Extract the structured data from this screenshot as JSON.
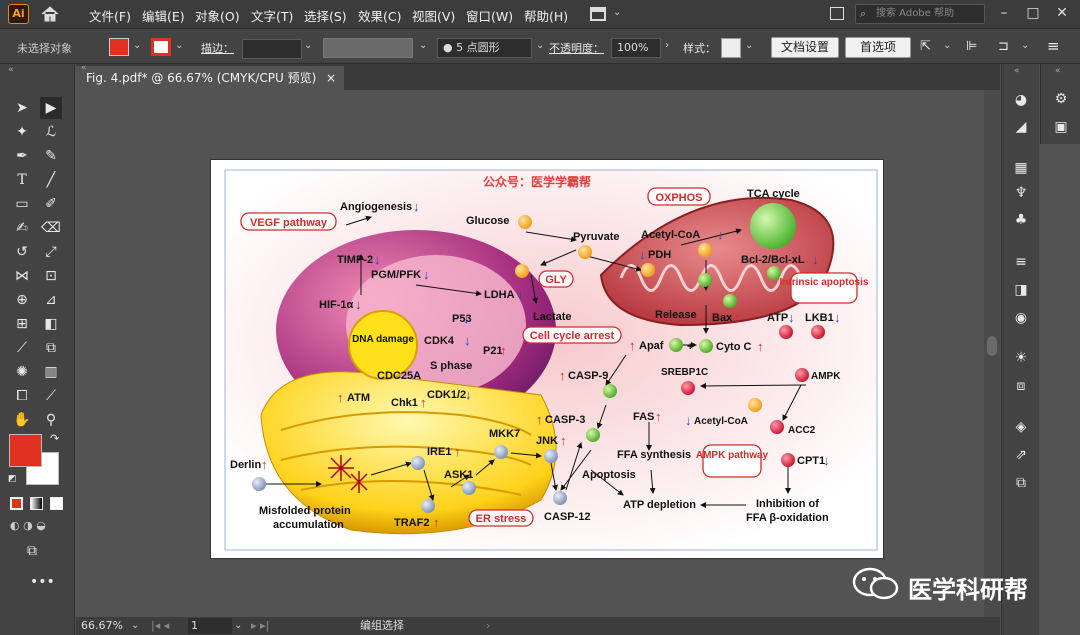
{
  "app": {
    "logo": "Ai",
    "home_icon": "home-icon"
  },
  "menu": [
    "文件(F)",
    "编辑(E)",
    "对象(O)",
    "文字(T)",
    "选择(S)",
    "效果(C)",
    "视图(V)",
    "窗口(W)",
    "帮助(H)"
  ],
  "search": {
    "placeholder": "搜索 Adobe 帮助"
  },
  "control_bar": {
    "selection_label": "未选择对象",
    "fill_color": "#e03020",
    "stroke_label": "描边：",
    "brush_value": "5 点圆形",
    "opacity_label": "不透明度：",
    "opacity_value": "100%",
    "style_label": "样式：",
    "doc_setup": "文档设置",
    "preferences": "首选项"
  },
  "document_tab": {
    "title": "Fig. 4.pdf* @ 66.67% (CMYK/CPU 预览)",
    "close": "×"
  },
  "status_bar": {
    "zoom": "66.67%",
    "artboard": "1",
    "tool_status": "编组选择"
  },
  "watermark": "医学科研帮",
  "figure": {
    "title_cn": "公众号：医学学霸帮",
    "pathway_labels": [
      "VEGF pathway",
      "OXPHOS",
      "GLY",
      "Cell cycle arrest",
      "Intrinsic apoptosis",
      "AMPK pathway",
      "ER stress"
    ],
    "nodes": [
      "Angiogenesis",
      "TIMP-2",
      "PGM/PFK",
      "HIF-1α",
      "DNA damage",
      "P53",
      "CDK4",
      "S phase",
      "P21",
      "CDC25A",
      "ATM",
      "Chk1",
      "CDK1/2",
      "Glucose",
      "Pyruvate",
      "LDHA",
      "Lactate",
      "Acetyl-CoA",
      "PDH",
      "TCA cycle",
      "Bcl-2/Bcl-xL",
      "Release",
      "Bax",
      "ATP",
      "LKB1",
      "Apaf",
      "+",
      "Cyto C",
      "SREBP1C",
      "AMPK",
      "CASP-9",
      "FAS",
      "Acetyl-CoA",
      "ACC2",
      "CASP-3",
      "JNK",
      "FFA synthesis",
      "CPT1",
      "Apoptosis",
      "ATP depletion",
      "Inhibition of",
      "FFA β-oxidation",
      "MKK7",
      "IRE1",
      "ASK1",
      "Derlin",
      "Misfolded protein",
      "accumulation",
      "TRAF2",
      "CASP-12"
    ]
  }
}
